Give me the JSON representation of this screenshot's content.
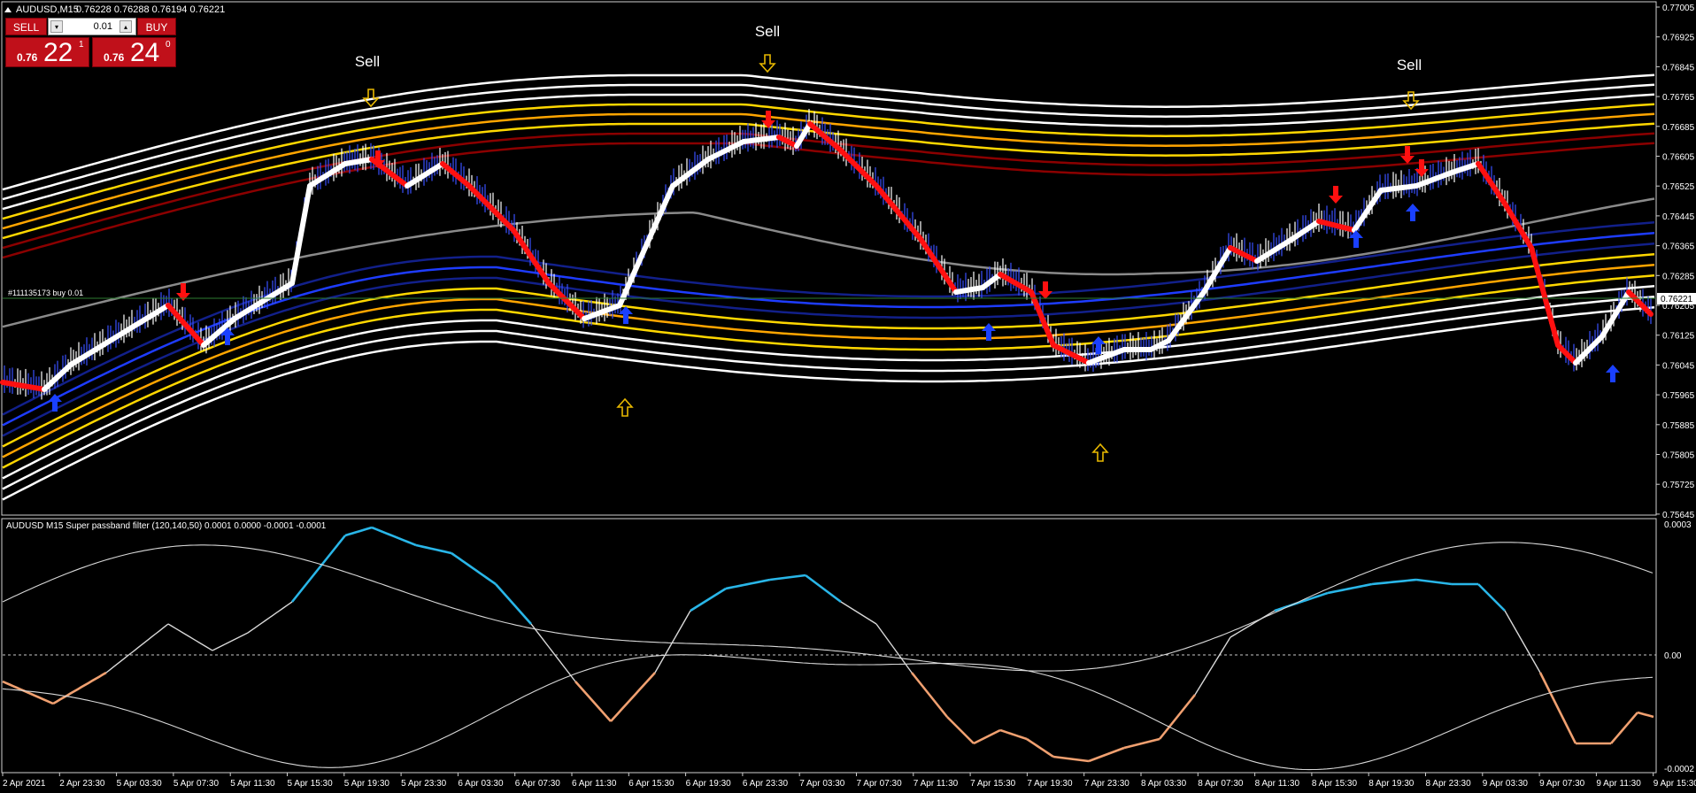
{
  "window": {
    "title": "AUDUSD,M15",
    "ohlc": "0.76228 0.76288 0.76194 0.76221",
    "corner_icon": "triangle-up-icon"
  },
  "one_click": {
    "sell_label": "SELL",
    "buy_label": "BUY",
    "lot_value": "0.01",
    "spin_down": "▾",
    "spin_up": "▴",
    "sell_price_small": "0.76",
    "sell_price_big": "22",
    "sell_price_sup": "1",
    "buy_price_small": "0.76",
    "buy_price_big": "24",
    "buy_price_sup": "0"
  },
  "order_line_label": "#111135173 buy 0.01",
  "current_price_label": "0.76221",
  "annotations": {
    "sell": "Sell"
  },
  "price_axis": [
    "0.77005",
    "0.76925",
    "0.76845",
    "0.76765",
    "0.76685",
    "0.76605",
    "0.76525",
    "0.76445",
    "0.76365",
    "0.76285",
    "0.76205",
    "0.76125",
    "0.76045",
    "0.75965",
    "0.75885",
    "0.75805",
    "0.75725",
    "0.75645"
  ],
  "indicator": {
    "title": "AUDUSD M15  Super passband filter (120,140,50) 0.0001 0.0000 -0.0001 -0.0001",
    "axis": [
      "0.0003",
      "0.00",
      "-0.0002"
    ]
  },
  "time_axis": [
    "2 Apr 2021",
    "2 Apr 23:30",
    "5 Apr 03:30",
    "5 Apr 07:30",
    "5 Apr 11:30",
    "5 Apr 15:30",
    "5 Apr 19:30",
    "5 Apr 23:30",
    "6 Apr 03:30",
    "6 Apr 07:30",
    "6 Apr 11:30",
    "6 Apr 15:30",
    "6 Apr 19:30",
    "6 Apr 23:30",
    "7 Apr 03:30",
    "7 Apr 07:30",
    "7 Apr 11:30",
    "7 Apr 15:30",
    "7 Apr 19:30",
    "7 Apr 23:30",
    "8 Apr 03:30",
    "8 Apr 07:30",
    "8 Apr 11:30",
    "8 Apr 15:30",
    "8 Apr 19:30",
    "8 Apr 23:30",
    "9 Apr 03:30",
    "9 Apr 07:30",
    "9 Apr 11:30",
    "9 Apr 15:30"
  ],
  "colors": {
    "background": "#000000",
    "sell_button": "#c0101a",
    "band_white": "#ffffff",
    "band_yellow": "#ffd700",
    "band_orange": "#ffa500",
    "band_darkred": "#8b0000",
    "band_blue": "#1e3cff",
    "band_navy": "#12208a",
    "midline_gray": "#8a8a8a",
    "trend_up": "#ffffff",
    "trend_down": "#ff1010",
    "arrow_up": "#1a40ff",
    "arrow_down": "#ff1010",
    "hollow_arrow": "#e8b800",
    "osc_cyan": "#29b6e8",
    "osc_orange": "#f0a070",
    "osc_line": "#d8d8d8",
    "order_line": "#2e7d32"
  }
}
